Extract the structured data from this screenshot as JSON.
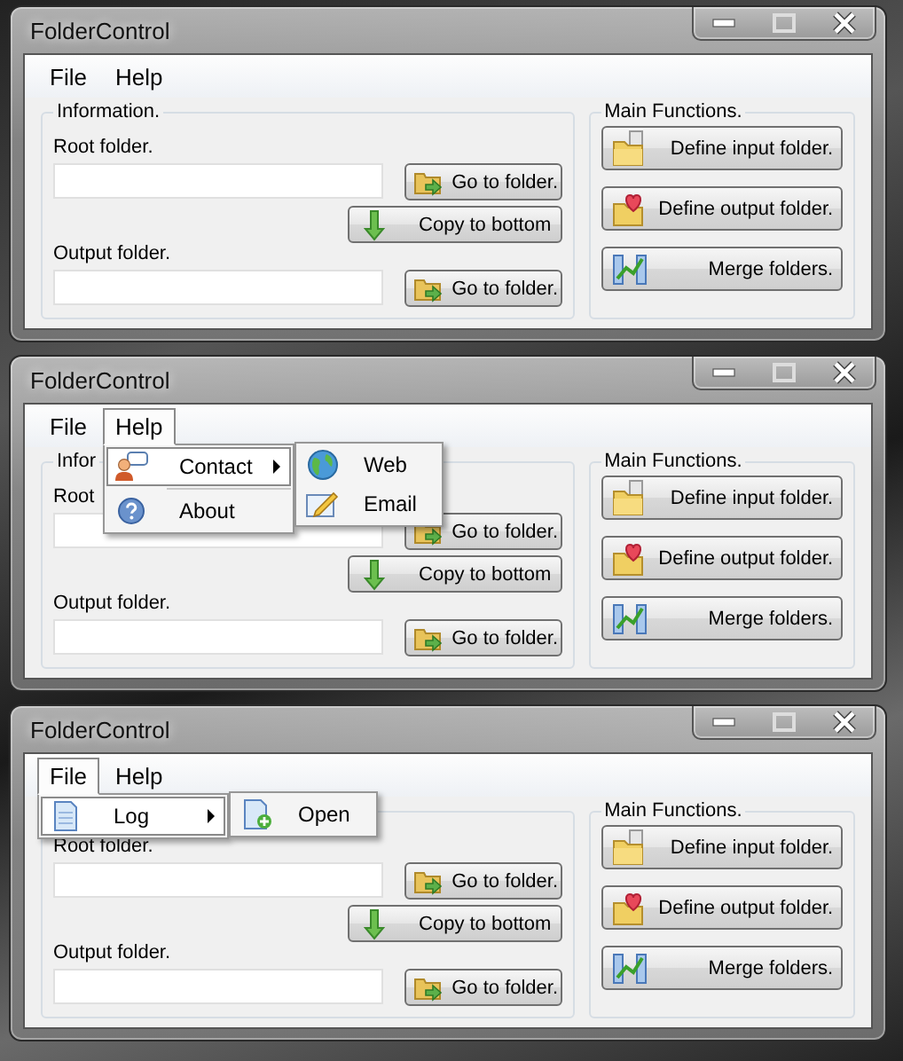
{
  "windows": [
    {
      "title": "FolderControl",
      "menu": [
        {
          "label": "File",
          "selected": false
        },
        {
          "label": "Help",
          "selected": false
        }
      ],
      "information": {
        "title": "Information.",
        "root_label": "Root folder.",
        "root_button": "Go to folder.",
        "copy_button": "Copy to bottom",
        "output_label": "Output folder.",
        "output_button": "Go to folder."
      },
      "main_functions": {
        "title": "Main Functions.",
        "buttons": [
          "Define input folder.",
          "Define output folder.",
          "Merge folders."
        ]
      }
    },
    {
      "title": "FolderControl",
      "menu": [
        {
          "label": "File",
          "selected": false
        },
        {
          "label": "Help",
          "selected": true
        }
      ],
      "dropdown": {
        "items": [
          {
            "label": "Contact",
            "selected": true,
            "submenu": true
          },
          {
            "label": "About",
            "selected": false,
            "submenu": false
          }
        ],
        "submenu_items": [
          {
            "label": "Web",
            "selected": false
          },
          {
            "label": "Email",
            "selected": false
          }
        ]
      },
      "information": {
        "title": "Infor",
        "root_label": "Root",
        "root_button": "Go to folder.",
        "copy_button": "Copy to bottom",
        "output_label": "Output folder.",
        "output_button": "Go to folder."
      },
      "main_functions": {
        "title": "Main Functions.",
        "buttons": [
          "Define input folder.",
          "Define output folder.",
          "Merge folders."
        ]
      }
    },
    {
      "title": "FolderControl",
      "menu": [
        {
          "label": "File",
          "selected": true
        },
        {
          "label": "Help",
          "selected": false
        }
      ],
      "dropdown": {
        "items": [
          {
            "label": "Log",
            "selected": true,
            "submenu": true
          }
        ],
        "submenu_items": [
          {
            "label": "Open",
            "selected": false
          }
        ]
      },
      "information": {
        "root_label": "Root folder.",
        "root_button": "Go to folder.",
        "copy_button": "Copy to bottom",
        "output_label": "Output folder.",
        "output_button": "Go to folder."
      },
      "main_functions": {
        "title": "Main Functions.",
        "buttons": [
          "Define input folder.",
          "Define output folder.",
          "Merge folders."
        ]
      }
    }
  ]
}
